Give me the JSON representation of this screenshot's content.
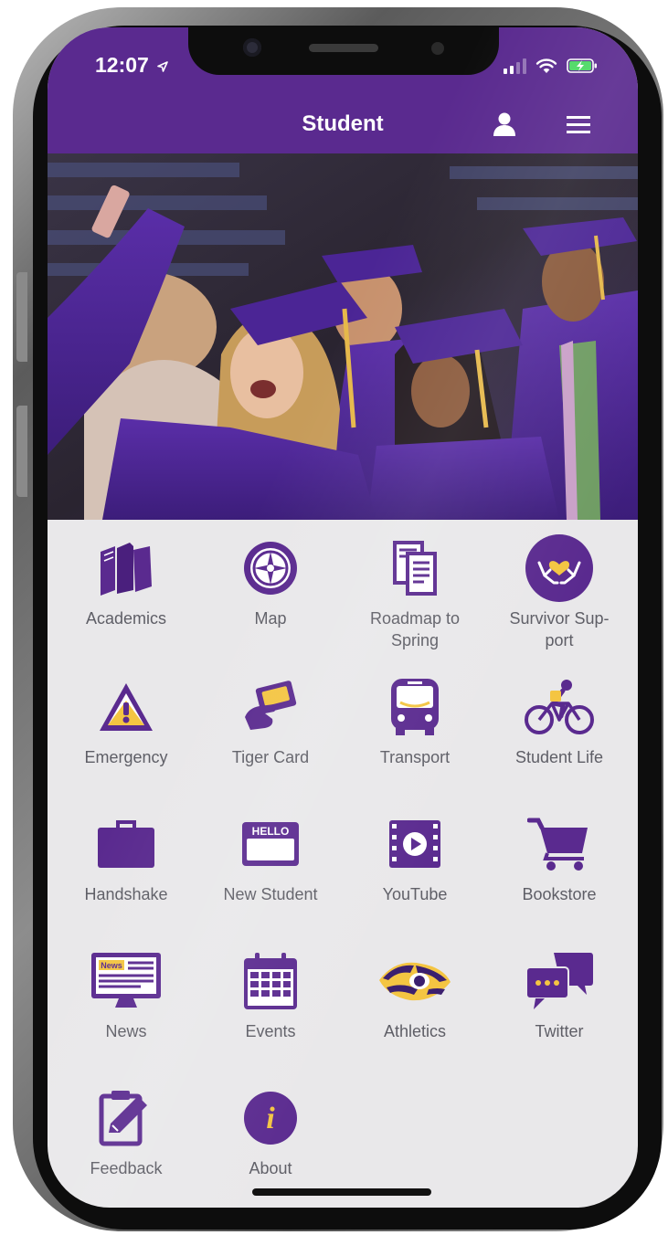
{
  "status_bar": {
    "time": "12:07"
  },
  "header": {
    "title": "Student"
  },
  "theme": {
    "purple": "#5a2a8f",
    "gold": "#f4c542",
    "label_gray": "#5e5e66",
    "background": "#e9e8ea"
  },
  "hero": {
    "icon": "graduation-selfie-photo"
  },
  "tiles": [
    {
      "label": "Academics",
      "icon": "books-icon"
    },
    {
      "label": "Map",
      "icon": "compass-icon"
    },
    {
      "label": "Roadmap to Spring",
      "icon": "documents-icon"
    },
    {
      "label": "Survivor Sup-port",
      "icon": "heart-hands-icon"
    },
    {
      "label": "Emergency",
      "icon": "warning-icon"
    },
    {
      "label": "Tiger Card",
      "icon": "id-card-icon"
    },
    {
      "label": "Transport",
      "icon": "bus-icon"
    },
    {
      "label": "Student Life",
      "icon": "cyclist-icon"
    },
    {
      "label": "Handshake",
      "icon": "briefcase-icon"
    },
    {
      "label": "New Student",
      "icon": "hello-badge-icon"
    },
    {
      "label": "YouTube",
      "icon": "video-play-icon"
    },
    {
      "label": "Bookstore",
      "icon": "shopping-cart-icon"
    },
    {
      "label": "News",
      "icon": "news-monitor-icon"
    },
    {
      "label": "Events",
      "icon": "calendar-icon"
    },
    {
      "label": "Athletics",
      "icon": "tiger-eye-logo-icon"
    },
    {
      "label": "Twitter",
      "icon": "chat-bubbles-icon"
    },
    {
      "label": "Feedback",
      "icon": "clipboard-edit-icon"
    },
    {
      "label": "About",
      "icon": "info-icon"
    }
  ],
  "icon_text": {
    "hello": "HELLO",
    "news": "News",
    "about": "i"
  }
}
